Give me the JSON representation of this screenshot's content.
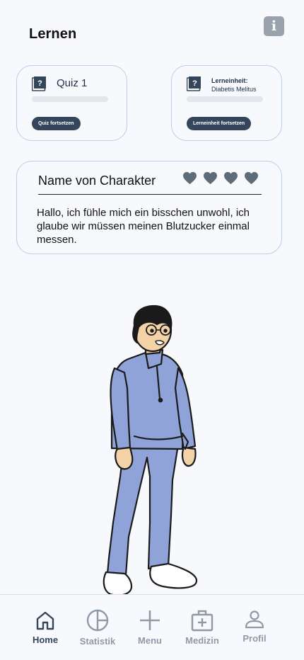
{
  "header": {
    "title": "Lernen",
    "info_label": "i"
  },
  "quiz_card": {
    "title": "Quiz 1",
    "progress": 0,
    "button_label": "Quiz fortsetzen"
  },
  "lesson_card": {
    "title": "Lerneinheit:",
    "subtitle": "Diabetis Melitus",
    "progress": 0,
    "button_label": "Lerneinheit fortsetzen"
  },
  "character_card": {
    "name": "Name von Charakter",
    "hearts": 4,
    "message": "Hallo, ich fühle mich ein bisschen unwohl, ich glaube wir müssen meinen Blutzucker einmal messen."
  },
  "bottom_nav": {
    "items": [
      {
        "label": "Home",
        "icon": "home-icon",
        "active": true
      },
      {
        "label": "Statistik",
        "icon": "pie-chart-icon",
        "active": false
      },
      {
        "label": "Menu",
        "icon": "plus-icon",
        "active": false
      },
      {
        "label": "Medizin",
        "icon": "medical-kit-icon",
        "active": false
      },
      {
        "label": "Profil",
        "icon": "user-icon",
        "active": false
      }
    ]
  },
  "colors": {
    "background": "#f7f9fd",
    "card_border": "#b9cfe6",
    "accent": "#34465c",
    "muted": "#8f9aa6",
    "heart": "#5e6b79",
    "tracksuit": "#8fa3d8"
  }
}
